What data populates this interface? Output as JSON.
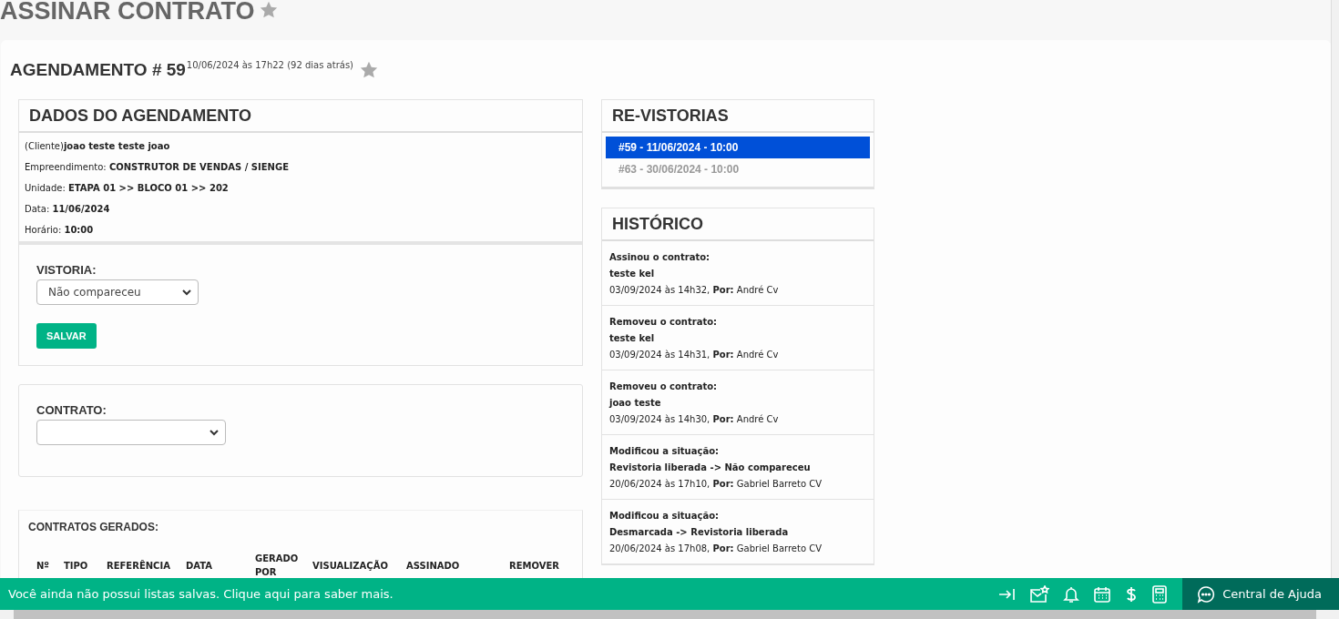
{
  "page_title": "ASSINAR CONTRATO",
  "page_favorite": false,
  "scheduling": {
    "title": "AGENDAMENTO # 59",
    "timestamp": "10/06/2024 às 17h22 (92 dias atrás)",
    "favorite": false
  },
  "details": {
    "title": "DADOS DO AGENDAMENTO",
    "fields": [
      "(Cliente)**joao teste teste joao**",
      "Empreendimento: **CONSTRUTOR DE VENDAS / SIENGE**",
      "Unidade: **ETAPA 01 >> BLOCO 01 >> 202**",
      "Data: **11/06/2024**",
      "Horário: **10:00**"
    ]
  },
  "vistoria": {
    "label": "VISTORIA:",
    "value": "Não compareceu",
    "button": "SALVAR"
  },
  "contrato": {
    "label": "CONTRATO:"
  },
  "generated": {
    "title": "CONTRATOS GERADOS:",
    "columns": [
      "Nº",
      "TIPO",
      "REFERÊNCIA",
      "DATA",
      "GERADO POR",
      "VISUALIZAÇÃO",
      "ASSINADO",
      "REMOVER"
    ]
  },
  "revistorias": {
    "title": "RE-VISTORIAS",
    "items": [
      {
        "label": "#59 - 11/06/2024 - 10:00",
        "selected": true
      },
      {
        "label": "#63 - 30/06/2024 - 10:00",
        "selected": false
      }
    ]
  },
  "history": {
    "title": "HISTÓRICO",
    "entries": [
      {
        "action": "Assinou o contrato:",
        "detail": "teste kel",
        "meta": "03/09/2024 às 14h32, **Por:** André Cv"
      },
      {
        "action": "Removeu o contrato:",
        "detail": "teste kel",
        "meta": "03/09/2024 às 14h31, **Por:** André Cv"
      },
      {
        "action": "Removeu o contrato:",
        "detail": "joao teste",
        "meta": "03/09/2024 às 14h30, **Por:** André Cv"
      },
      {
        "action": "Modificou a situação:",
        "detail": "Revistoria liberada -> Não compareceu",
        "meta": "20/06/2024 às 17h10, **Por:** Gabriel Barreto CV"
      },
      {
        "action": "Modificou a situação:",
        "detail": "Desmarcada -> Revistoria liberada",
        "meta": "20/06/2024 às 17h08, **Por:** Gabriel Barreto CV"
      }
    ]
  },
  "footer": {
    "message": "Você ainda não possui listas salvas. Clique aqui para saber mais.",
    "help": "Central de Ajuda"
  }
}
